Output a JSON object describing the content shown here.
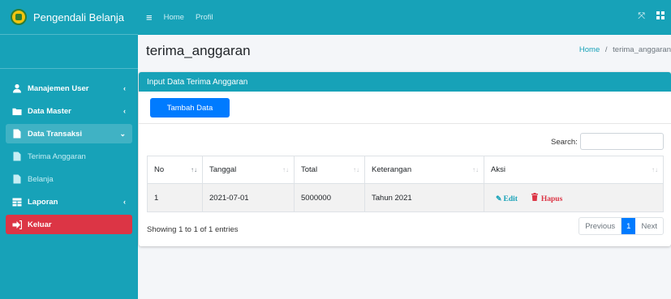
{
  "brand": {
    "title": "Pengendali Belanja"
  },
  "topnav": {
    "home": "Home",
    "profil": "Profil"
  },
  "sidebar": {
    "items": [
      {
        "label": "Manajemen User",
        "icon": "user-icon",
        "caret": "‹"
      },
      {
        "label": "Data Master",
        "icon": "folder-icon",
        "caret": "‹"
      },
      {
        "label": "Data Transaksi",
        "icon": "document-icon",
        "caret": "⌄"
      },
      {
        "label": "Terima Anggaran",
        "icon": "document-icon"
      },
      {
        "label": "Belanja",
        "icon": "document-icon"
      },
      {
        "label": "Laporan",
        "icon": "table-icon",
        "caret": "‹"
      },
      {
        "label": "Keluar",
        "icon": "logout-icon"
      }
    ]
  },
  "page": {
    "title": "terima_anggaran",
    "breadcrumb_home": "Home",
    "breadcrumb_sep": "/",
    "breadcrumb_current": "terima_anggaran"
  },
  "card": {
    "header": "Input Data Terima Anggaran",
    "add_button": "Tambah Data",
    "search_label": "Search:",
    "search_value": ""
  },
  "table": {
    "headers": [
      "No",
      "Tanggal",
      "Total",
      "Keterangan",
      "Aksi"
    ],
    "rows": [
      {
        "no": "1",
        "tanggal": "2021-07-01",
        "total": "5000000",
        "keterangan": "Tahun 2021",
        "edit": "Edit",
        "hapus": "Hapus"
      }
    ]
  },
  "footer": {
    "info": "Showing 1 to 1 of 1 entries",
    "prev": "Previous",
    "page": "1",
    "next": "Next"
  },
  "colors": {
    "primary_teal": "#17a2b8",
    "button_blue": "#007bff",
    "danger_red": "#dc3545"
  }
}
